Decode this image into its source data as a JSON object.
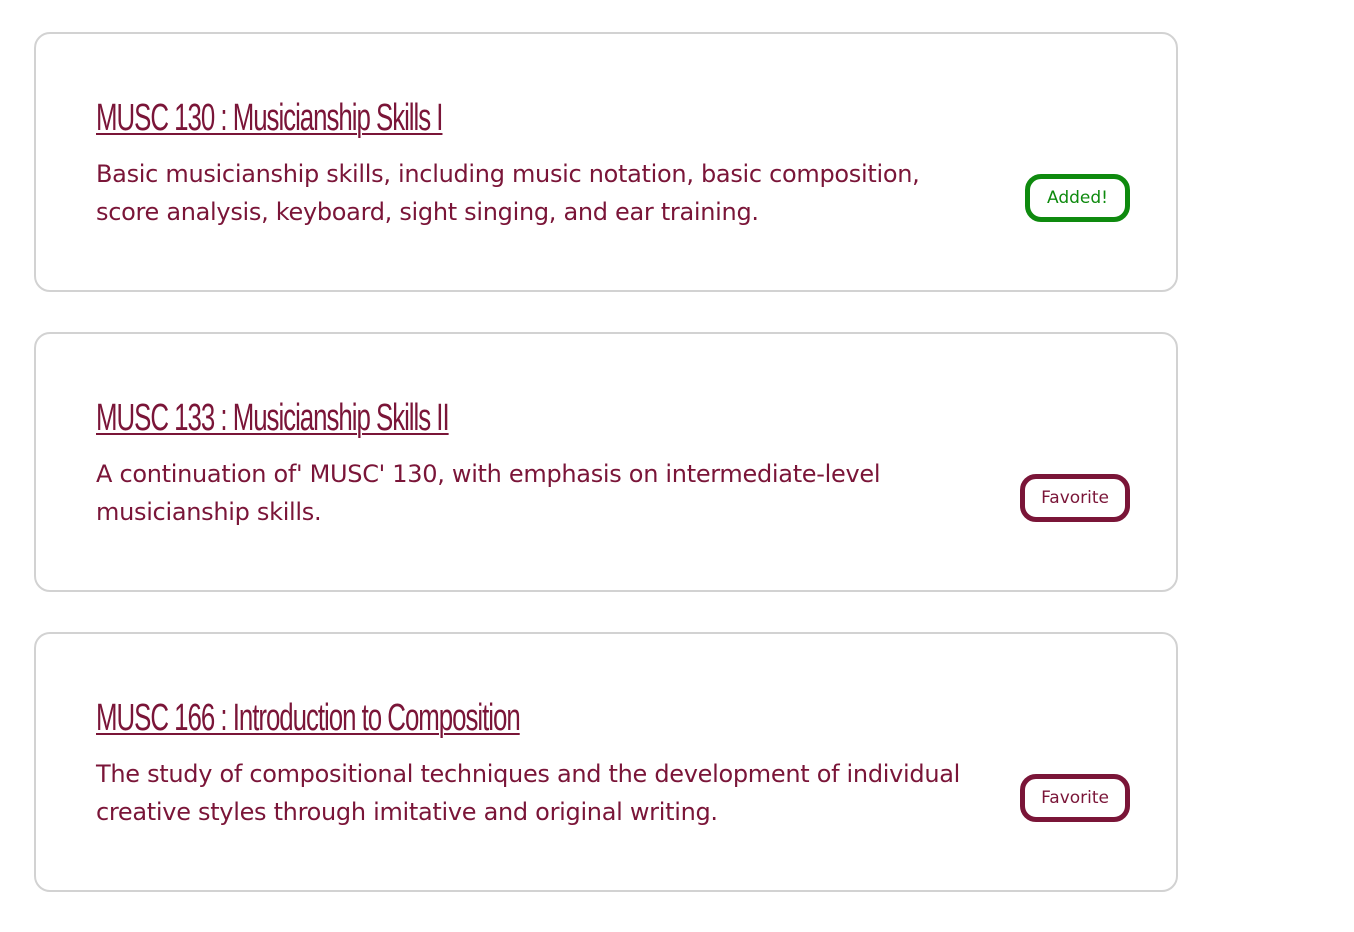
{
  "courses": [
    {
      "title": "MUSC 130 : Musicianship Skills I",
      "description": "Basic musicianship skills, including music notation, basic composition, score analysis, keyboard, sight singing, and ear training.",
      "button_label": "Added!",
      "added": true
    },
    {
      "title": "MUSC 133 : Musicianship Skills II",
      "description": "A continuation of' MUSC' 130, with emphasis on intermediate-level musicianship skills.",
      "button_label": "Favorite",
      "added": false
    },
    {
      "title": "MUSC 166 : Introduction to Composition",
      "description": "The study of compositional techniques and the development of individual creative styles through imitative and original writing.",
      "button_label": "Favorite",
      "added": false
    }
  ],
  "colors": {
    "accent": "#7a1538",
    "added": "#0e8a0e",
    "card_border": "#d2d2d2"
  }
}
